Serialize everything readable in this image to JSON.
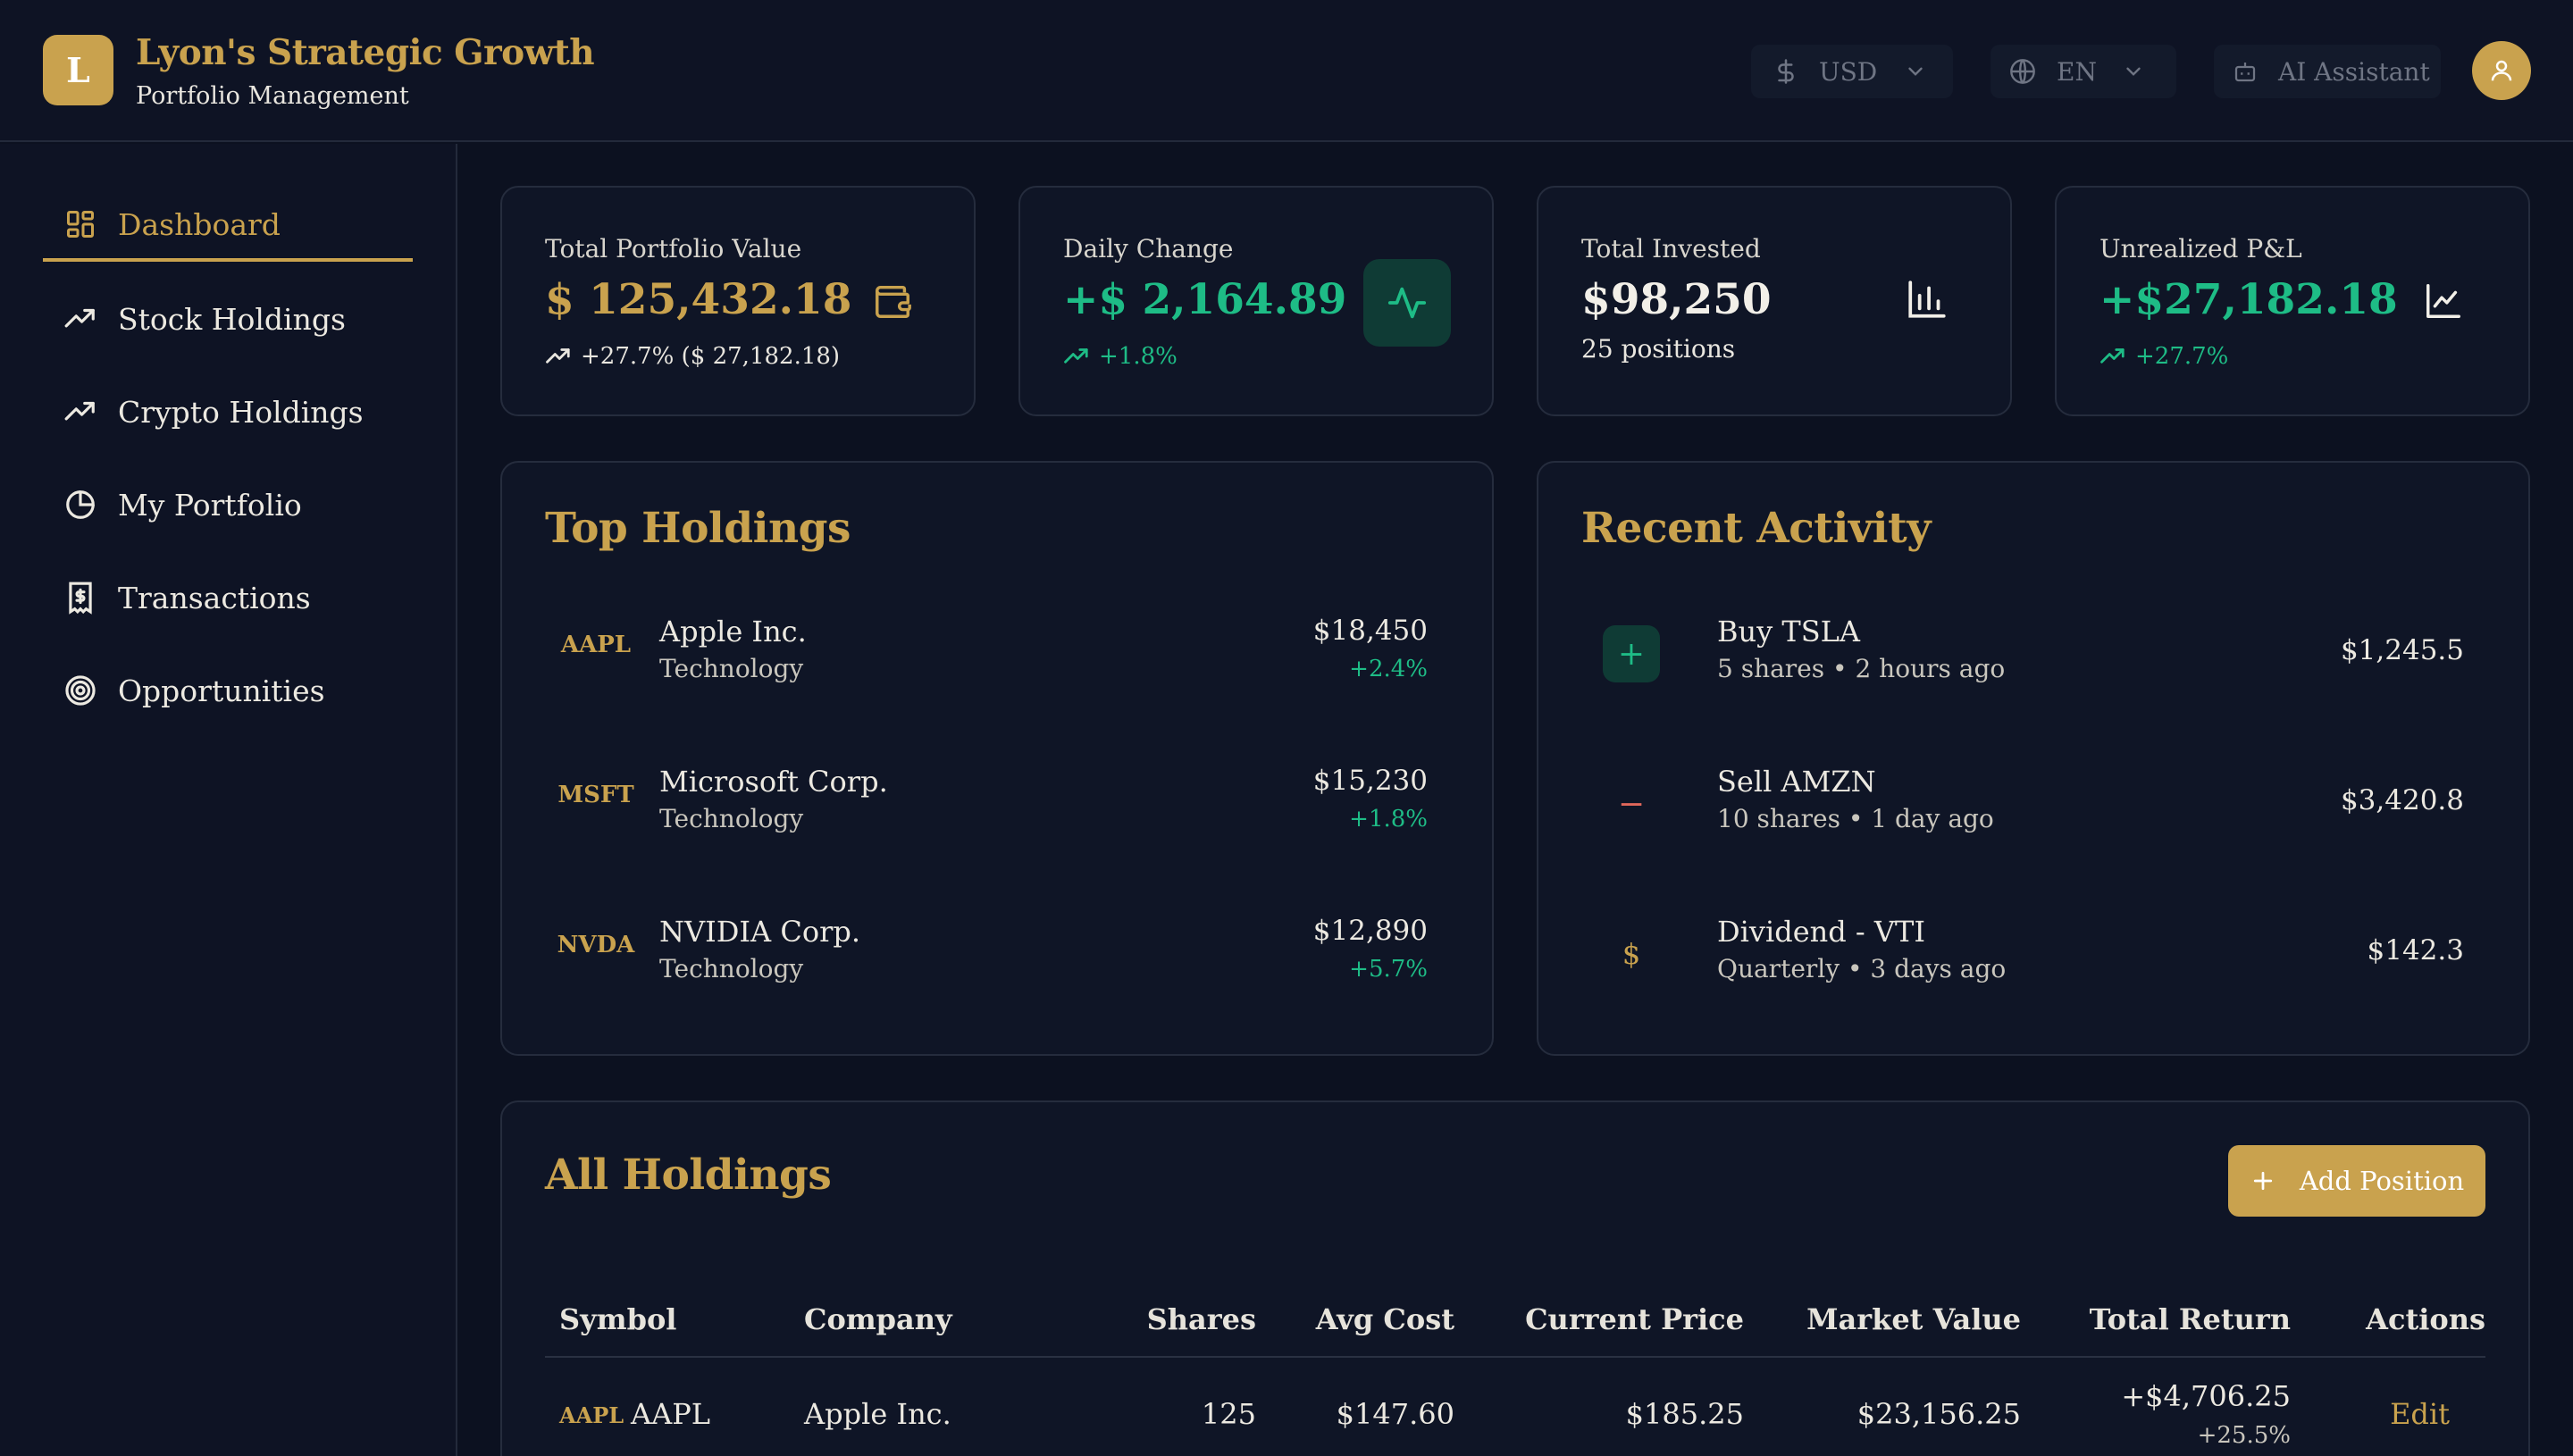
{
  "header": {
    "logo_letter": "L",
    "title": "Lyon's Strategic Growth",
    "subtitle": "Portfolio Management",
    "currency": "USD",
    "language": "EN",
    "assistant": "AI Assistant"
  },
  "sidebar": {
    "items": [
      {
        "label": "Dashboard",
        "icon": "dashboard-grid-icon"
      },
      {
        "label": "Stock Holdings",
        "icon": "trending-up-icon"
      },
      {
        "label": "Crypto Holdings",
        "icon": "trending-up-icon"
      },
      {
        "label": "My Portfolio",
        "icon": "pie-chart-icon"
      },
      {
        "label": "Transactions",
        "icon": "receipt-dollar-icon"
      },
      {
        "label": "Opportunities",
        "icon": "target-icon"
      }
    ]
  },
  "stats": {
    "total_value": {
      "label": "Total Portfolio Value",
      "value": "$ 125,432.18",
      "sub": "+27.7% ($ 27,182.18)"
    },
    "daily_change": {
      "label": "Daily Change",
      "value": "+$ 2,164.89",
      "sub": "+1.8%"
    },
    "total_invested": {
      "label": "Total Invested",
      "value": "$98,250",
      "sub": "25 positions"
    },
    "unrealized": {
      "label": "Unrealized P&L",
      "value": "+$27,182.18",
      "sub": "+27.7%"
    }
  },
  "top_holdings": {
    "title": "Top Holdings",
    "items": [
      {
        "symbol": "AAPL",
        "name": "Apple Inc.",
        "sector": "Technology",
        "value": "$18,450",
        "change": "+2.4%"
      },
      {
        "symbol": "MSFT",
        "name": "Microsoft Corp.",
        "sector": "Technology",
        "value": "$15,230",
        "change": "+1.8%"
      },
      {
        "symbol": "NVDA",
        "name": "NVIDIA Corp.",
        "sector": "Technology",
        "value": "$12,890",
        "change": "+5.7%"
      }
    ]
  },
  "recent_activity": {
    "title": "Recent Activity",
    "items": [
      {
        "icon": "+",
        "title": "Buy TSLA",
        "detail": "5 shares • 2 hours ago",
        "amount": "$1,245.5"
      },
      {
        "icon": "−",
        "title": "Sell AMZN",
        "detail": "10 shares • 1 day ago",
        "amount": "$3,420.8"
      },
      {
        "icon": "$",
        "title": "Dividend - VTI",
        "detail": "Quarterly • 3 days ago",
        "amount": "$142.3"
      }
    ]
  },
  "all_holdings": {
    "title": "All Holdings",
    "add_label": "Add Position",
    "columns": [
      "Symbol",
      "Company",
      "Shares",
      "Avg Cost",
      "Current Price",
      "Market Value",
      "Total Return",
      "Actions"
    ],
    "rows": [
      {
        "badge": "AAPL",
        "symbol": "AAPL",
        "company": "Apple Inc.",
        "shares": "125",
        "avg_cost": "$147.60",
        "price": "$185.25",
        "market_value": "$23,156.25",
        "return_value": "+$4,706.25",
        "return_pct": "+25.5%",
        "action": "Edit"
      }
    ]
  },
  "colors": {
    "accent": "#c9a24e",
    "positive": "#1ebc86",
    "negative": "#e0675a",
    "background": "#0c1120"
  }
}
